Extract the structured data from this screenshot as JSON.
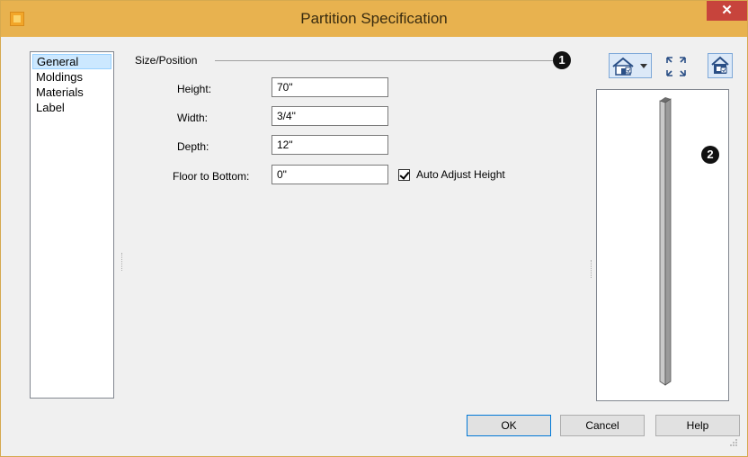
{
  "window": {
    "title": "Partition Specification",
    "close_glyph": "✕"
  },
  "nav": {
    "items": [
      {
        "label": "General",
        "selected": true
      },
      {
        "label": "Moldings",
        "selected": false
      },
      {
        "label": "Materials",
        "selected": false
      },
      {
        "label": "Label",
        "selected": false
      }
    ]
  },
  "size_position": {
    "group_label": "Size/Position",
    "fields": [
      {
        "label": "Height:",
        "value": "70\""
      },
      {
        "label": "Width:",
        "value": "3/4\""
      },
      {
        "label": "Depth:",
        "value": "12\""
      },
      {
        "label": "Floor to Bottom:",
        "value": "0\""
      }
    ],
    "auto_adjust": {
      "label": "Auto Adjust Height",
      "checked": true
    }
  },
  "markers": {
    "one": "1",
    "two": "2"
  },
  "toolbar": {
    "icons": [
      "house-view-dropdown-icon",
      "fill-window-icon",
      "preview-mode-icon"
    ]
  },
  "buttons": {
    "ok": "OK",
    "cancel": "Cancel",
    "help": "Help"
  },
  "colors": {
    "titlebar": "#e8b24f",
    "close": "#c7443c",
    "selection": "#cce8ff"
  }
}
